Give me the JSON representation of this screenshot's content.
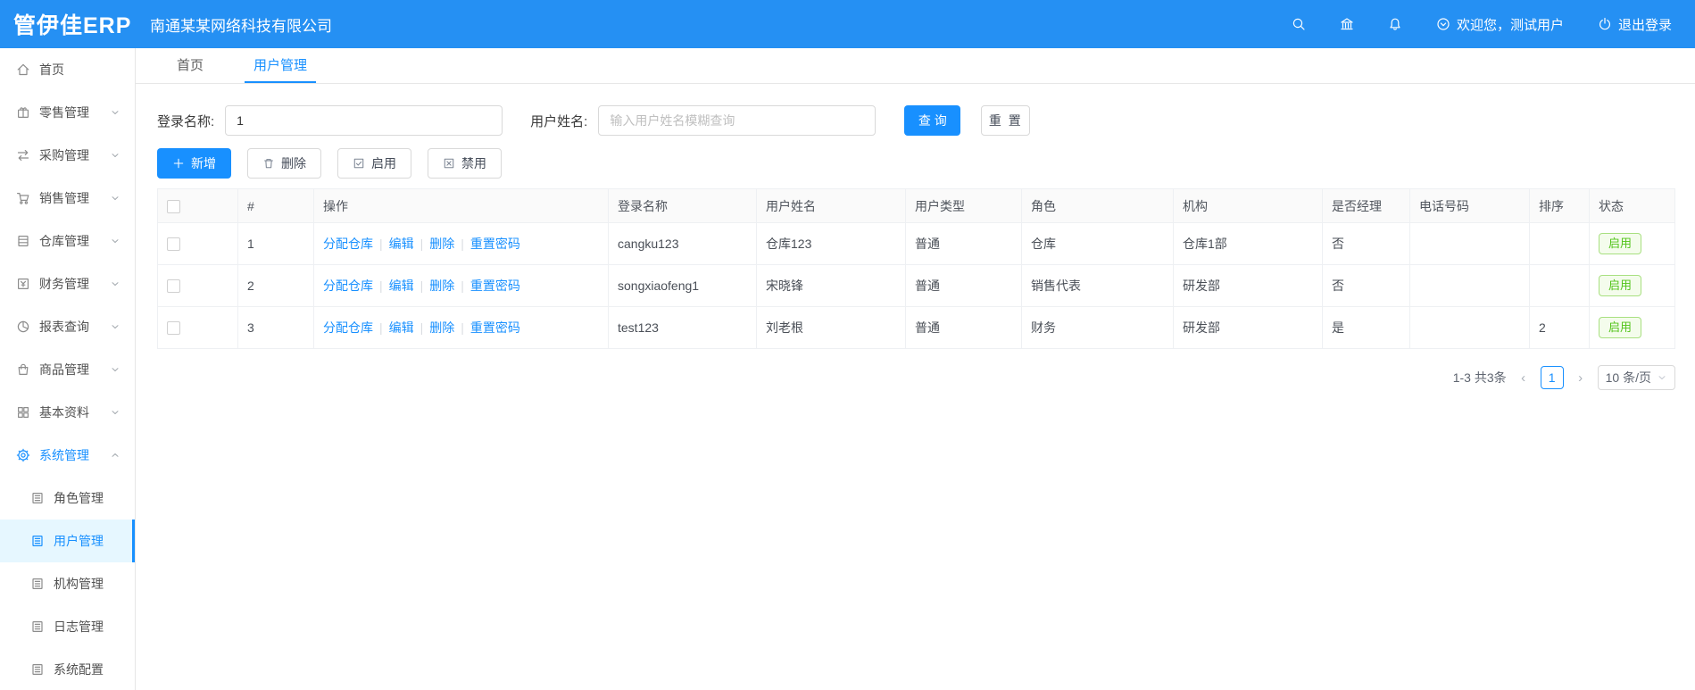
{
  "colors": {
    "header_bg": "#2590f3",
    "accent_blue": "#1890ff",
    "active_item_bg": "#e6f7ff",
    "badge_green_text": "#52c41a",
    "badge_green_border": "#a8e080",
    "badge_green_bg": "#f4fcec"
  },
  "header": {
    "logo": "管伊佳ERP",
    "company": "南通某某网络科技有限公司",
    "icons": [
      "search-icon",
      "bank-icon",
      "bell-icon"
    ],
    "welcome_icon": "circle-chevron-down-icon",
    "welcome": "欢迎您，测试用户",
    "logout_icon": "power-icon",
    "logout": "退出登录"
  },
  "sidebar": {
    "items": [
      {
        "label": "首页",
        "icon": "home-icon",
        "chevron": null,
        "sub": false,
        "active": false
      },
      {
        "label": "零售管理",
        "icon": "gift-icon",
        "chevron": "down",
        "sub": false,
        "active": false
      },
      {
        "label": "采购管理",
        "icon": "swap-icon",
        "chevron": "down",
        "sub": false,
        "active": false
      },
      {
        "label": "销售管理",
        "icon": "cart-icon",
        "chevron": "down",
        "sub": false,
        "active": false
      },
      {
        "label": "仓库管理",
        "icon": "server-icon",
        "chevron": "down",
        "sub": false,
        "active": false
      },
      {
        "label": "财务管理",
        "icon": "finance-icon",
        "chevron": "down",
        "sub": false,
        "active": false
      },
      {
        "label": "报表查询",
        "icon": "pie-chart-icon",
        "chevron": "down",
        "sub": false,
        "active": false
      },
      {
        "label": "商品管理",
        "icon": "bag-icon",
        "chevron": "down",
        "sub": false,
        "active": false
      },
      {
        "label": "基本资料",
        "icon": "grid-icon",
        "chevron": "down",
        "sub": false,
        "active": false
      },
      {
        "label": "系统管理",
        "icon": "gear-icon",
        "chevron": "up",
        "sub": false,
        "active": true
      },
      {
        "label": "角色管理",
        "icon": "doc-icon",
        "chevron": null,
        "sub": true,
        "active": false
      },
      {
        "label": "用户管理",
        "icon": "doc-icon",
        "chevron": null,
        "sub": true,
        "active": true
      },
      {
        "label": "机构管理",
        "icon": "doc-icon",
        "chevron": null,
        "sub": true,
        "active": false
      },
      {
        "label": "日志管理",
        "icon": "doc-icon",
        "chevron": null,
        "sub": true,
        "active": false
      },
      {
        "label": "系统配置",
        "icon": "doc-icon",
        "chevron": null,
        "sub": true,
        "active": false
      }
    ]
  },
  "tabs": [
    {
      "label": "首页",
      "active": false
    },
    {
      "label": "用户管理",
      "active": true
    }
  ],
  "search": {
    "login_label": "登录名称:",
    "login_value": "1",
    "name_label": "用户姓名:",
    "name_placeholder": "输入用户姓名模糊查询",
    "query_label": "查 询",
    "reset_label": "重 置"
  },
  "toolbar": {
    "add_label": "新增",
    "delete_label": "删除",
    "enable_label": "启用",
    "disable_label": "禁用"
  },
  "table": {
    "columns": [
      "#",
      "操作",
      "登录名称",
      "用户姓名",
      "用户类型",
      "角色",
      "机构",
      "是否经理",
      "电话号码",
      "排序",
      "状态"
    ],
    "action_links": [
      "分配仓库",
      "编辑",
      "删除",
      "重置密码"
    ],
    "rows": [
      {
        "index": "1",
        "login": "cangku123",
        "name": "仓库123",
        "type": "普通",
        "role": "仓库",
        "org": "仓库1部",
        "manager": "否",
        "phone": "",
        "sort": "",
        "status": "启用"
      },
      {
        "index": "2",
        "login": "songxiaofeng1",
        "name": "宋晓锋",
        "type": "普通",
        "role": "销售代表",
        "org": "研发部",
        "manager": "否",
        "phone": "",
        "sort": "",
        "status": "启用"
      },
      {
        "index": "3",
        "login": "test123",
        "name": "刘老根",
        "type": "普通",
        "role": "财务",
        "org": "研发部",
        "manager": "是",
        "phone": "",
        "sort": "2",
        "status": "启用"
      }
    ]
  },
  "pagination": {
    "summary": "1-3 共3条",
    "prev": "‹",
    "page": "1",
    "next": "›",
    "page_size": "10 条/页"
  }
}
